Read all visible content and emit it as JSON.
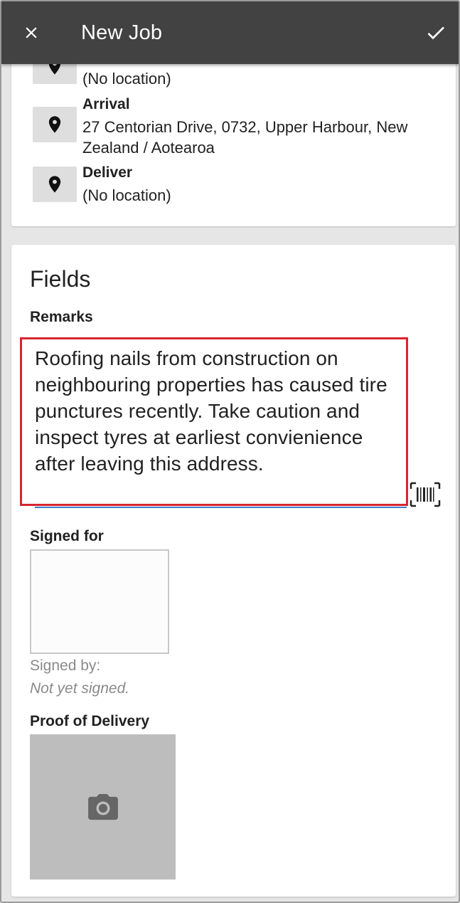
{
  "appbar": {
    "title": "New Job"
  },
  "locations": [
    {
      "label": "",
      "value": "(No location)"
    },
    {
      "label": "Arrival",
      "value": "27 Centorian Drive, 0732, Upper Harbour, New Zealand / Aotearoa"
    },
    {
      "label": "Deliver",
      "value": "(No location)"
    }
  ],
  "fields": {
    "title": "Fields",
    "remarks": {
      "label": "Remarks",
      "value": "Roofing nails from construction on neighbouring properties has caused tire punctures recently. Take caution and inspect tyres at earliest convienience after leaving this address."
    },
    "signed_for": {
      "label": "Signed for",
      "signed_by_label": "Signed by:",
      "status": "Not yet signed."
    },
    "proof_of_delivery": {
      "label": "Proof of Delivery"
    }
  },
  "colors": {
    "appbar": "#424242",
    "highlight": "#d9252e",
    "underline": "#3d7fc4",
    "photo_placeholder": "#bdbdbd"
  },
  "icons": {
    "close": "close-icon",
    "confirm": "check-icon",
    "location": "location-pin-icon",
    "scan": "barcode-scan-icon",
    "camera": "camera-icon"
  }
}
